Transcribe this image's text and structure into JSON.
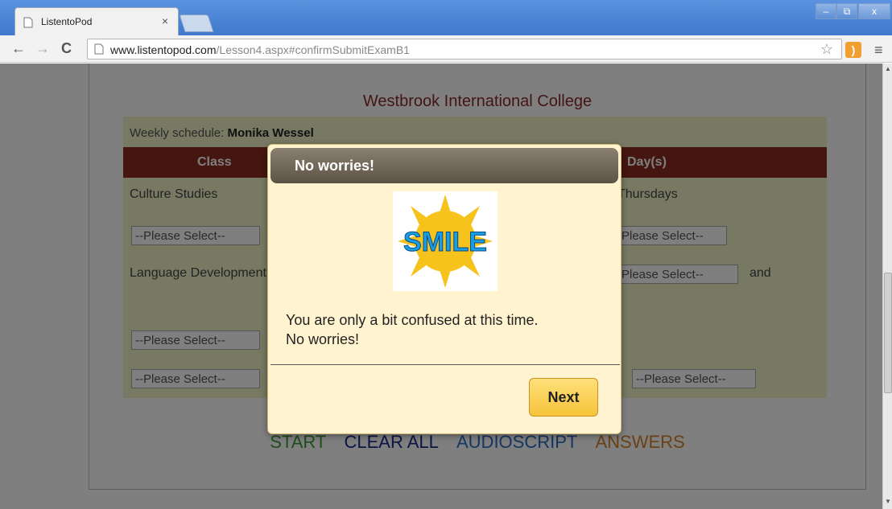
{
  "browser": {
    "tab_title": "ListentoPod",
    "tab_close": "×",
    "url_host": "www.listentopod.com",
    "url_path": "/Lesson4.aspx#confirmSubmitExamB1",
    "window_controls": {
      "min": "–",
      "max": "⧉",
      "close": "x"
    },
    "back": "←",
    "forward": "→",
    "reload": "C",
    "star": "☆",
    "menu": "≡"
  },
  "page": {
    "college": "Westbrook International College",
    "weekly_label": "Weekly schedule:",
    "weekly_name": "Monika Wessel",
    "col_class": "Class",
    "col_days": "Day(s)",
    "rows": [
      {
        "class": "Culture Studies",
        "day": "Thursdays"
      },
      {
        "class": "Language Development",
        "and": "and"
      }
    ],
    "select_placeholder": "--Please Select--",
    "links": {
      "start": "START",
      "clear_all": "CLEAR ALL",
      "audioscript": "AUDIOSCRIPT",
      "answers": "ANSWERS"
    }
  },
  "dialog": {
    "title": "No worries!",
    "image_text": "SMILE",
    "message_line1": "You are only a bit confused at this time.",
    "message_line2": "No worries!",
    "next_label": "Next"
  },
  "colors": {
    "header_maroon": "#8b2d1f",
    "schedule_bg": "#f1f3c4",
    "dialog_bg": "#fff3d0",
    "next_button": "#f6c33b",
    "start": "#3f9c3a",
    "clear_all": "#1a2a8a",
    "audioscript": "#2b6fc0",
    "answers": "#d4822a"
  }
}
